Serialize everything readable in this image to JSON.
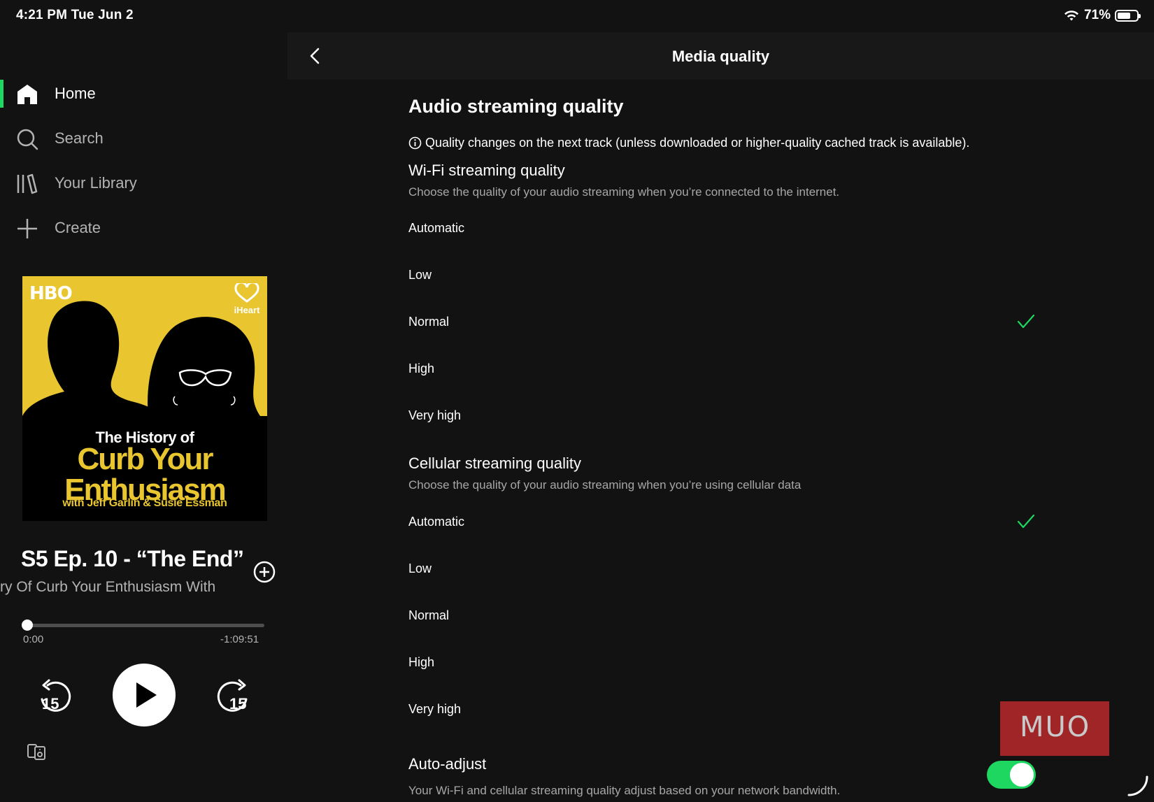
{
  "status_bar": {
    "time": "4:21 PM  Tue Jun 2",
    "battery": "71%",
    "battery_level": 0.71
  },
  "sidebar": {
    "nav": [
      {
        "label": "Home",
        "icon": "home-icon",
        "active": true
      },
      {
        "label": "Search",
        "icon": "search-icon",
        "active": false
      },
      {
        "label": "Your Library",
        "icon": "library-icon",
        "active": false
      },
      {
        "label": "Create",
        "icon": "plus-icon",
        "active": false
      }
    ]
  },
  "now_playing": {
    "cover": {
      "top_left": "HBO",
      "top_right": "iHeart",
      "line1": "The History of",
      "line2a": "Curb Your",
      "line2b": "Enthusiasm",
      "line3": "with Jeff Garlin & Susie Essman"
    },
    "episode_title": "S5 Ep. 10 - “The End”",
    "show_name": "ry Of Curb Your Enthusiasm With",
    "elapsed": "0:00",
    "remaining": "-1:09:51",
    "progress": 0.0,
    "skip_back_label": "15",
    "skip_forward_label": "15"
  },
  "main": {
    "title": "Media quality",
    "section_title": "Audio streaming quality",
    "info": "Quality changes on the next track (unless downloaded or higher-quality cached track is available).",
    "wifi": {
      "title": "Wi-Fi streaming quality",
      "description": "Choose the quality of your audio streaming when you’re connected to the internet.",
      "options": [
        "Automatic",
        "Low",
        "Normal",
        "High",
        "Very high"
      ],
      "selected": "Normal"
    },
    "cellular": {
      "title": "Cellular streaming quality",
      "description": "Choose the quality of your audio streaming when you’re using cellular data",
      "options": [
        "Automatic",
        "Low",
        "Normal",
        "High",
        "Very high"
      ],
      "selected": "Automatic"
    },
    "auto_adjust": {
      "title": "Auto-adjust",
      "description": "Your Wi-Fi and cellular streaming quality adjust based on your network bandwidth.",
      "enabled": true
    }
  },
  "watermark": "MUO",
  "colors": {
    "accent": "#1ed760",
    "background": "#121212",
    "cover_yellow": "#e9c630"
  }
}
